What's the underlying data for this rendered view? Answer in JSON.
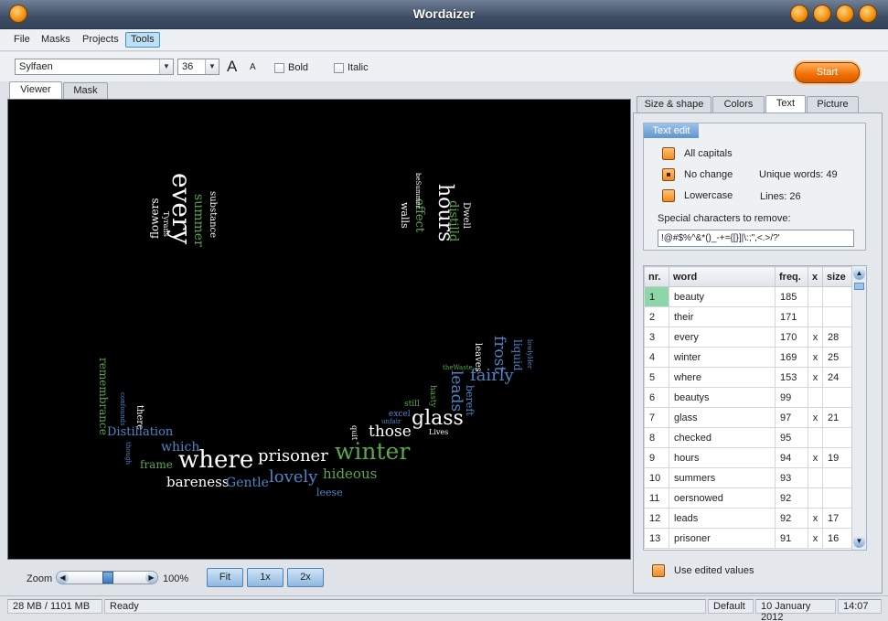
{
  "window": {
    "title": "Wordaizer"
  },
  "menu": [
    "File",
    "Masks",
    "Projects",
    "Tools"
  ],
  "toolbar": {
    "font": "Sylfaen",
    "size": "36",
    "grow_label": "A",
    "shrink_label": "A",
    "bold_label": "Bold",
    "italic_label": "Italic",
    "start_label": "Start"
  },
  "viewer_tabs": [
    "Viewer",
    "Mask"
  ],
  "right_tabs": [
    "Size & shape",
    "Colors",
    "Text",
    "Picture"
  ],
  "text_edit": {
    "header": "Text edit",
    "options": [
      "All capitals",
      "No change",
      "Lowercase"
    ],
    "selected_option": "No change",
    "unique_words_label": "Unique words: 49",
    "lines_label": "Lines: 26",
    "special_label": "Special characters to remove:",
    "special_value": "!@#$%^&*()_-+={[}]|\\:;\",<.>/?'"
  },
  "table": {
    "headers": [
      "nr.",
      "word",
      "freq.",
      "x",
      "size"
    ],
    "rows": [
      {
        "nr": "1",
        "word": "beauty",
        "freq": "185",
        "x": "",
        "size": ""
      },
      {
        "nr": "2",
        "word": "their",
        "freq": "171",
        "x": "",
        "size": ""
      },
      {
        "nr": "3",
        "word": "every",
        "freq": "170",
        "x": "x",
        "size": "28"
      },
      {
        "nr": "4",
        "word": "winter",
        "freq": "169",
        "x": "x",
        "size": "25"
      },
      {
        "nr": "5",
        "word": "where",
        "freq": "153",
        "x": "x",
        "size": "24"
      },
      {
        "nr": "6",
        "word": "beautys",
        "freq": "99",
        "x": "",
        "size": ""
      },
      {
        "nr": "7",
        "word": "glass",
        "freq": "97",
        "x": "x",
        "size": "21"
      },
      {
        "nr": "8",
        "word": "checked",
        "freq": "95",
        "x": "",
        "size": ""
      },
      {
        "nr": "9",
        "word": "hours",
        "freq": "94",
        "x": "x",
        "size": "19"
      },
      {
        "nr": "10",
        "word": "summers",
        "freq": "93",
        "x": "",
        "size": ""
      },
      {
        "nr": "11",
        "word": "oersnowed",
        "freq": "92",
        "x": "",
        "size": ""
      },
      {
        "nr": "12",
        "word": "leads",
        "freq": "92",
        "x": "x",
        "size": "17"
      },
      {
        "nr": "13",
        "word": "prisoner",
        "freq": "91",
        "x": "x",
        "size": "16"
      }
    ]
  },
  "use_edited_label": "Use edited values",
  "zoom": {
    "label": "Zoom",
    "percent": "100%",
    "buttons": [
      "Fit",
      "1x",
      "2x"
    ]
  },
  "status": {
    "memory": "28 MB / 1101 MB",
    "state": "Ready",
    "profile": "Default",
    "date": "10 January 2012",
    "time": "14:07"
  },
  "colors": {
    "accent_orange": "#f08c1c",
    "word_white": "#ffffff",
    "word_green": "#5aa84a",
    "word_blue": "#4f86c6"
  },
  "cloud_words": [
    "every",
    "summer",
    "substance",
    "flowers",
    "Tyrans",
    "hours",
    "distilld",
    "effect",
    "Dwell",
    "walls",
    "beSummer",
    "remembrance",
    "confounds",
    "there",
    "though",
    "Distillation",
    "which",
    "frame",
    "where",
    "bareness",
    "Gentle",
    "prisoner",
    "lovely",
    "leese",
    "hideous",
    "winter",
    "those",
    "quit",
    "glass",
    "Lives",
    "unfair",
    "excel",
    "still",
    "hasty",
    "leads",
    "theWaste",
    "bereft",
    "fairly",
    "frost",
    "liquid",
    "leaves",
    "lowlyHer"
  ]
}
